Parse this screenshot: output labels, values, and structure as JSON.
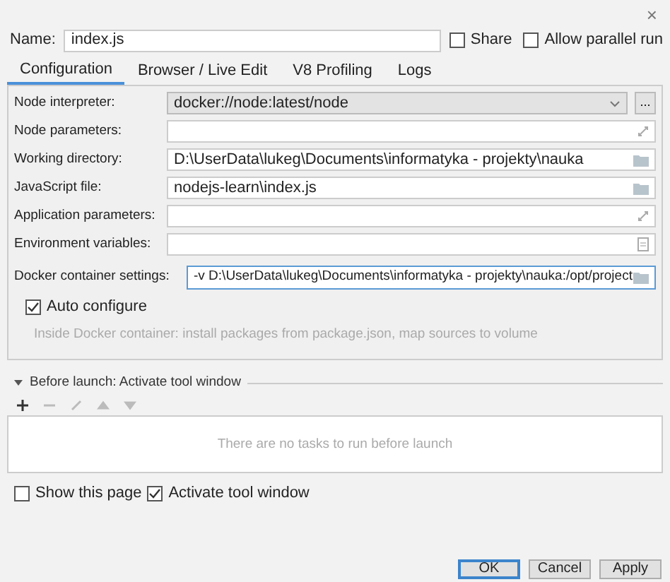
{
  "close_glyph": "×",
  "name": {
    "label": "Name:",
    "value": "index.js"
  },
  "options": [
    {
      "label": "Share",
      "checked": false
    },
    {
      "label": "Allow parallel run",
      "checked": false
    }
  ],
  "tabs": [
    {
      "label": "Configuration",
      "selected": true
    },
    {
      "label": "Browser / Live Edit",
      "selected": false
    },
    {
      "label": "V8 Profiling",
      "selected": false
    },
    {
      "label": "Logs",
      "selected": false
    }
  ],
  "fields": [
    {
      "label": "Node interpreter:",
      "value": "docker://node:latest/node",
      "kind": "combo",
      "button": "..."
    },
    {
      "label": "Node parameters:",
      "kind": "expand"
    },
    {
      "label": "Working directory:",
      "value": "D:\\UserData\\lukeg\\Documents\\informatyka - projekty\\nauka",
      "kind": "browse"
    },
    {
      "label": "JavaScript file:",
      "value": "nodejs-learn\\index.js",
      "kind": "browse"
    },
    {
      "label": "Application parameters:",
      "kind": "expand"
    },
    {
      "label": "Environment variables:",
      "kind": "list"
    }
  ],
  "docker": {
    "label": "Docker container settings:",
    "value": "-v D:\\UserData\\lukeg\\Documents\\informatyka - projekty\\nauka:/opt/project",
    "focused": true
  },
  "auto_configure": {
    "label": "Auto configure",
    "checked": true,
    "hint": "Inside Docker container: install packages from package.json, map sources to volume"
  },
  "before_launch": {
    "title": "Before launch: Activate tool window",
    "expanded": true,
    "tools": [
      {
        "kind": "add",
        "disabled": false
      },
      {
        "kind": "remove",
        "disabled": true
      },
      {
        "kind": "edit",
        "disabled": true
      },
      {
        "kind": "up",
        "disabled": true
      },
      {
        "kind": "down",
        "disabled": true
      }
    ],
    "empty_text": "There are no tasks to run before launch"
  },
  "bottom_options": [
    {
      "label": "Show this page",
      "checked": false
    },
    {
      "label": "Activate tool window",
      "checked": true
    }
  ],
  "buttons": [
    {
      "label": "OK",
      "selected": true
    },
    {
      "label": "Cancel",
      "selected": false
    },
    {
      "label": "Apply",
      "selected": false
    }
  ]
}
